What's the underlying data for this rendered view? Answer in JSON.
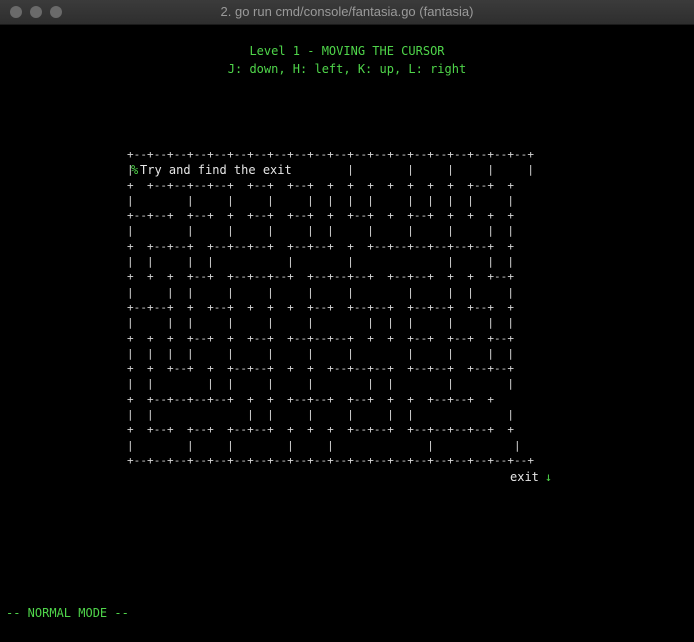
{
  "window": {
    "title": "2. go run cmd/console/fantasia.go (fantasia)"
  },
  "header": {
    "level_title": "Level 1 - MOVING THE CURSOR",
    "keys": "J: down, H: left, K: up, L: right"
  },
  "maze": {
    "cursor": "%",
    "hint": "Try and find the exit",
    "exit_label": "exit",
    "exit_arrow": "↓",
    "rows": [
      "+--+--+--+--+--+--+--+--+--+--+--+--+--+--+--+--+--+--+--+--+",
      "|                       |        |        |     |     |     |",
      "+  +--+--+--+--+  +--+  +--+  +  +  +  +  +  +  +  +--+  +",
      "|        |     |     |     |  |  |  |     |  |  |  |     |",
      "+--+--+  +--+  +  +--+  +--+  +  +--+  +  +--+  +  +  +  +",
      "|        |     |     |     |  |     |     |     |     |  |",
      "+  +--+--+  +--+--+--+  +--+--+  +  +--+--+--+--+--+--+  +",
      "|  |     |  |           |        |              |     |  |",
      "+  +  +  +--+  +--+--+--+  +--+--+--+  +--+--+  +  +  +--+",
      "|     |  |     |     |     |     |        |     |  |     |",
      "+--+--+  +  +--+  +  +  +  +--+  +--+--+  +--+--+  +--+  +",
      "|     |  |     |     |     |        |  |  |     |     |  |",
      "+  +  +  +--+  +  +--+  +--+--+--+  +  +  +--+  +--+  +--+",
      "|  |  |  |     |     |     |     |        |     |     |  |",
      "+  +  +--+  +  +--+--+  +  +  +--+--+--+  +--+--+  +--+--+",
      "|  |        |  |     |     |        |  |        |        |",
      "+  +--+--+--+--+  +  +  +--+--+  +--+  +  +  +--+--+  +",
      "|  |              |  |     |     |     |  |              |",
      "+  +--+  +--+  +--+--+  +  +  +  +--+--+  +--+--+--+--+  +",
      "|        |     |        |     |              |            |",
      "+--+--+--+--+--+--+--+--+--+--+--+--+--+--+--+--+--+--+--+--+"
    ]
  },
  "status": {
    "mode": "-- NORMAL MODE --"
  },
  "colors": {
    "accent_green": "#4fd54a",
    "maze_gray": "#d6d6d6",
    "background": "#000000"
  }
}
